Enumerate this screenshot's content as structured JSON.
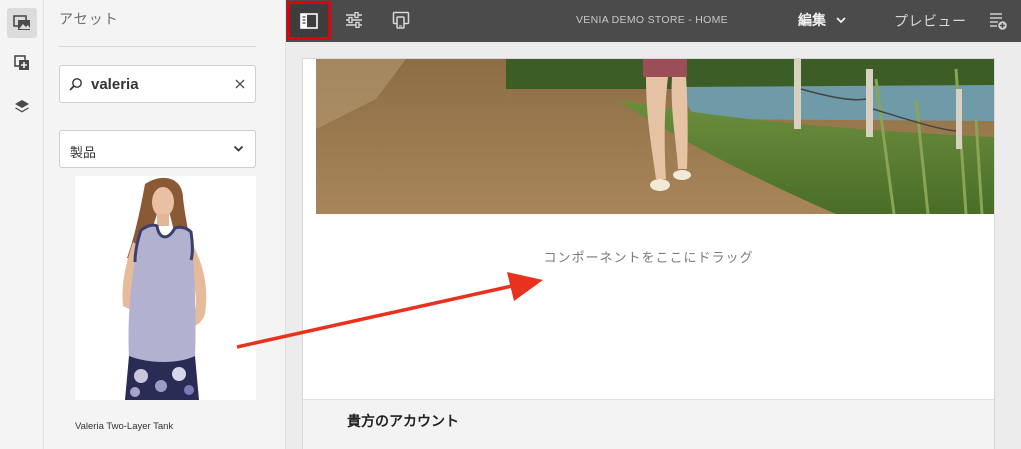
{
  "rail": {
    "items": [
      {
        "name": "assets",
        "icon": "assets-icon",
        "active": true
      },
      {
        "name": "components",
        "icon": "components-icon",
        "active": false
      },
      {
        "name": "content-tree",
        "icon": "layers-icon",
        "active": false
      }
    ]
  },
  "panel": {
    "title": "アセット",
    "search": {
      "value": "valeria",
      "placeholder": ""
    },
    "filter": {
      "selected": "製品"
    },
    "results": [
      {
        "caption": "Valeria Two-Layer Tank"
      }
    ]
  },
  "topbar": {
    "page_name": "VENIA DEMO STORE - HOME",
    "mode_label": "編集",
    "preview_label": "プレビュー"
  },
  "canvas": {
    "dropzone_label": "コンポーネントをここにドラッグ",
    "account_title": "貴方のアカウント"
  },
  "colors": {
    "topbar": "#4b4b4b",
    "highlight": "#e1000f",
    "arrow": "#e8321e"
  }
}
